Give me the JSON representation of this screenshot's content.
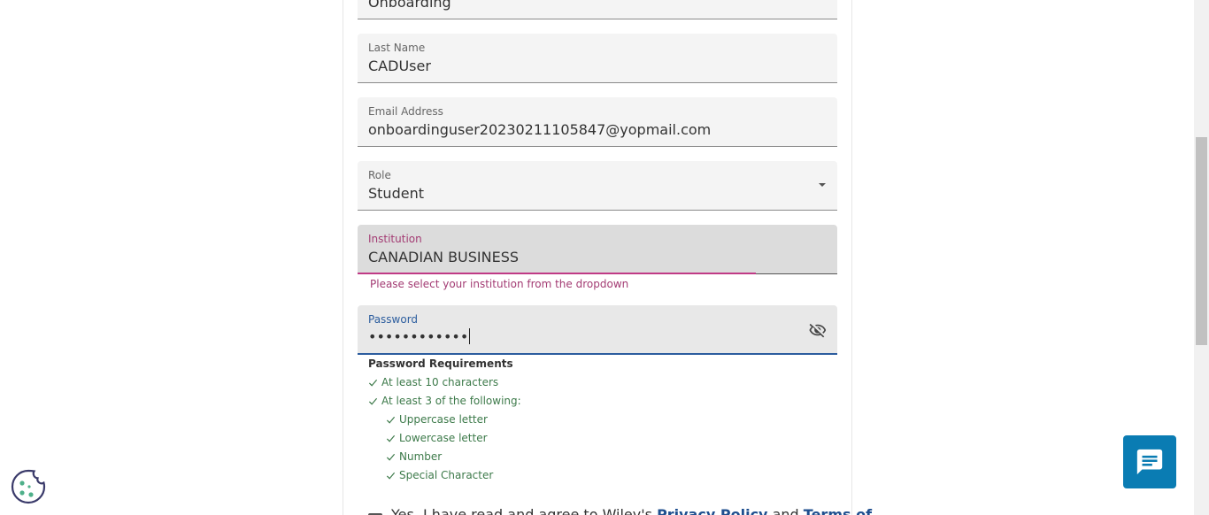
{
  "form": {
    "first_name": {
      "value": "Onboarding"
    },
    "last_name": {
      "label": "Last Name",
      "value": "CADUser"
    },
    "email": {
      "label": "Email Address",
      "value": "onboardinguser20230211105847@yopmail.com"
    },
    "role": {
      "label": "Role",
      "value": "Student"
    },
    "institution": {
      "label": "Institution",
      "value": "CANADIAN BUSINESS",
      "error": "Please select your institution from the dropdown"
    },
    "password": {
      "label": "Password",
      "value": "••••••••••••"
    }
  },
  "password_requirements": {
    "title": "Password Requirements",
    "items": [
      "At least 10 characters",
      "At least 3 of the following:",
      "Uppercase letter",
      "Lowercase letter",
      "Number",
      "Special Character"
    ]
  },
  "agreement": {
    "prefix": "Yes, I have read and agree to Wiley's",
    "privacy_link": "Privacy Policy",
    "conjunction": "and",
    "terms_link": "Terms of"
  },
  "icons": {
    "password_toggle": "eye-off-icon",
    "chat": "chat-icon",
    "cookie": "cookie-icon",
    "check": "check-icon",
    "dropdown": "chevron-down-icon"
  },
  "colors": {
    "error": "#a33b73",
    "focus": "#2c5d9e",
    "success": "#3d7a4a",
    "chat_button": "#0a7cb3",
    "link": "#1f4f8f"
  }
}
